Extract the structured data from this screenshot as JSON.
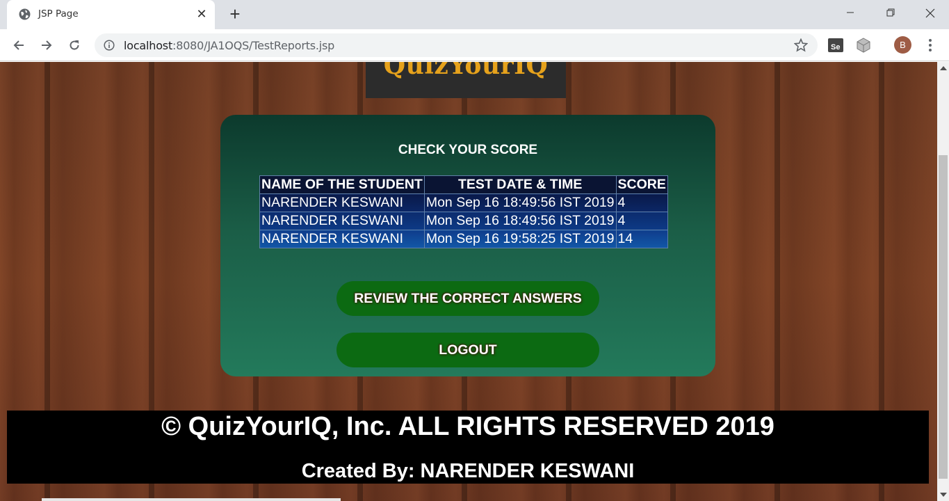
{
  "browser": {
    "tab_title": "JSP Page",
    "tab_close": "✕",
    "new_tab": "+",
    "url_host": "localhost",
    "url_path": ":8080/JA1OQS/TestReports.jsp",
    "avatar_letter": "B"
  },
  "page": {
    "logo_text": "QuizYourIQ",
    "panel_title": "CHECK YOUR SCORE",
    "table": {
      "headers": [
        "NAME OF THE STUDENT",
        "TEST DATE & TIME",
        "SCORE"
      ],
      "rows": [
        [
          "NARENDER KESWANI",
          "Mon Sep 16 18:49:56 IST 2019",
          "4"
        ],
        [
          "NARENDER KESWANI",
          "Mon Sep 16 18:49:56 IST 2019",
          "4"
        ],
        [
          "NARENDER KESWANI",
          "Mon Sep 16 19:58:25 IST 2019",
          "14"
        ]
      ]
    },
    "review_button": "REVIEW THE CORRECT ANSWERS",
    "logout_button": "LOGOUT",
    "footer": {
      "copyright": "© QuizYourIQ, Inc. ALL RIGHTS RESERVED 2019",
      "created_by": "Created By: NARENDER KESWANI"
    }
  },
  "colors": {
    "panel_top": "#0c3a2d",
    "panel_bottom": "#237a5b",
    "button_green": "#0c6a12",
    "logo_gold": "#e6a21c"
  }
}
